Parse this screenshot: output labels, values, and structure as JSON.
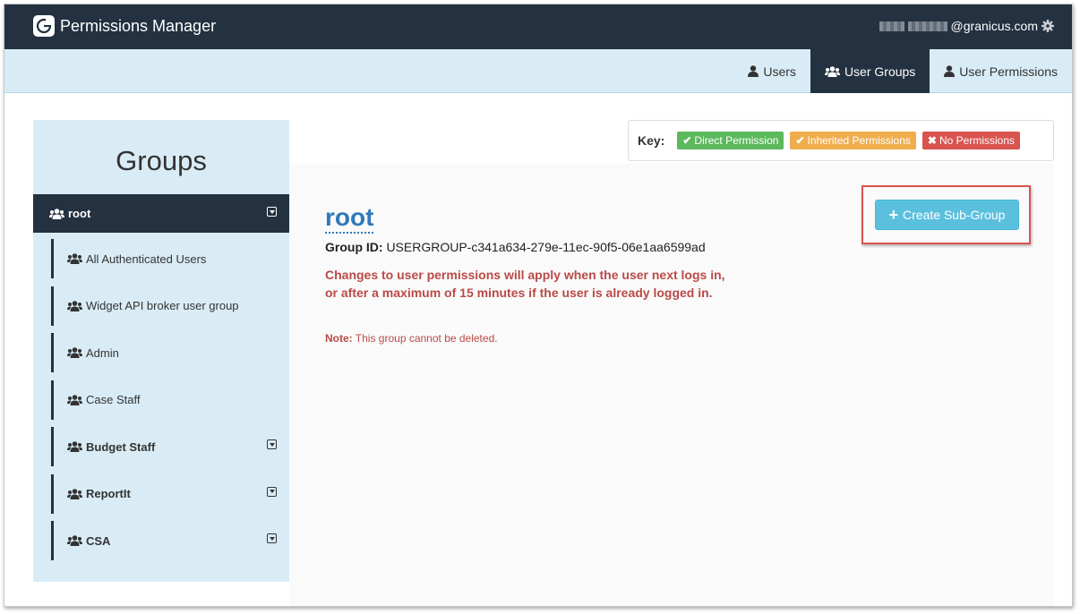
{
  "header": {
    "app_title": "Permissions Manager",
    "user_email_suffix": "@granicus.com",
    "icons": {
      "logo": "granicus-logo",
      "settings": "gear-icon"
    }
  },
  "nav": {
    "tabs": [
      {
        "label": "Users",
        "icon": "user-icon",
        "active": false
      },
      {
        "label": "User Groups",
        "icon": "users-icon",
        "active": true
      },
      {
        "label": "User Permissions",
        "icon": "user-icon",
        "active": false
      }
    ]
  },
  "sidebar": {
    "title": "Groups",
    "root": {
      "label": "root"
    },
    "items": [
      {
        "label": "All Authenticated Users",
        "bold": false,
        "expandable": false
      },
      {
        "label": "Widget API broker user group",
        "bold": false,
        "expandable": false
      },
      {
        "label": "Admin",
        "bold": false,
        "expandable": false
      },
      {
        "label": "Case Staff",
        "bold": false,
        "expandable": false
      },
      {
        "label": "Budget Staff",
        "bold": true,
        "expandable": true
      },
      {
        "label": "ReportIt",
        "bold": true,
        "expandable": true
      },
      {
        "label": "CSA",
        "bold": true,
        "expandable": true
      }
    ]
  },
  "key": {
    "label": "Key:",
    "direct": "Direct Permission",
    "inherited": "Inherited Permissions",
    "none": "No Permissions",
    "colors": {
      "direct": "#5cb85c",
      "inherited": "#f0ad4e",
      "none": "#d9534f"
    }
  },
  "group": {
    "name": "root",
    "id_label": "Group ID:",
    "id_value": "USERGROUP-c341a634-279e-11ec-90f5-06e1aa6599ad",
    "warning": "Changes to user permissions will apply when the user next logs in, or after a maximum of 15 minutes if the user is already logged in.",
    "note_label": "Note:",
    "note_text": "This group cannot be deleted."
  },
  "actions": {
    "create_subgroup": "Create Sub-Group"
  }
}
